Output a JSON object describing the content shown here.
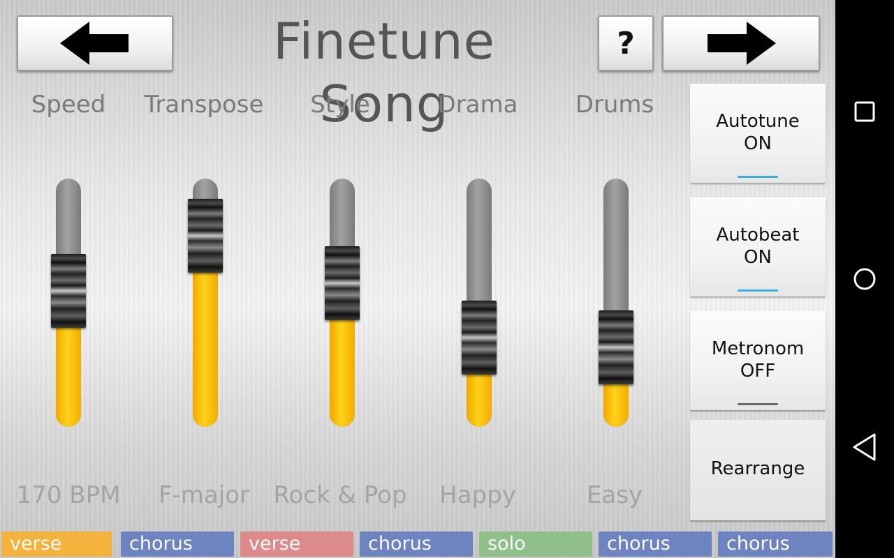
{
  "header": {
    "title": "Finetune Song",
    "help_label": "?",
    "back_icon": "arrow-left-icon",
    "forward_icon": "arrow-right-icon"
  },
  "sliders": [
    {
      "label": "Speed",
      "value_text": "170 BPM",
      "level": 0.4
    },
    {
      "label": "Transpose",
      "value_text": "F-major",
      "level": 0.62
    },
    {
      "label": "Style",
      "value_text": "Rock & Pop",
      "level": 0.43
    },
    {
      "label": "Drama",
      "value_text": "Happy",
      "level": 0.21
    },
    {
      "label": "Drums",
      "value_text": "Easy",
      "level": 0.17
    }
  ],
  "side_buttons": {
    "autotune": {
      "line1": "Autotune",
      "line2": "ON",
      "state": "on"
    },
    "autobeat": {
      "line1": "Autobeat",
      "line2": "ON",
      "state": "on"
    },
    "metronome": {
      "line1": "Metronom",
      "line2": "OFF",
      "state": "off"
    },
    "rearrange": {
      "label": "Rearrange"
    }
  },
  "sections": [
    {
      "label": "verse",
      "color": "#f4b33c"
    },
    {
      "label": "chorus",
      "color": "#6e84c0"
    },
    {
      "label": "verse",
      "color": "#dc8a8a"
    },
    {
      "label": "chorus",
      "color": "#6e84c0"
    },
    {
      "label": "solo",
      "color": "#8fc08a"
    },
    {
      "label": "chorus",
      "color": "#6e84c0"
    },
    {
      "label": "chorus",
      "color": "#6e84c0"
    }
  ],
  "colors": {
    "accent_on": "#3aaee0",
    "indicator_off": "#6a6a6a",
    "slider_fill": "#ffc814"
  },
  "system_nav": [
    "square-icon",
    "circle-icon",
    "triangle-back-icon"
  ]
}
